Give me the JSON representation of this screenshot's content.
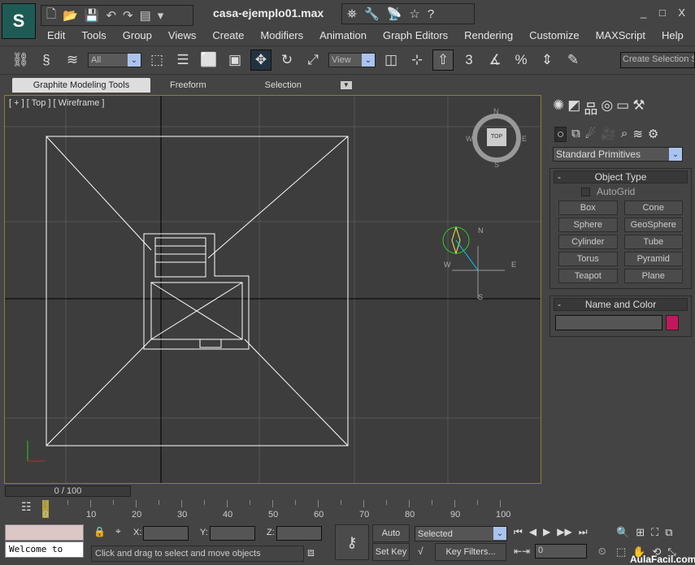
{
  "app": {
    "title": "casa-ejemplo01.max",
    "logo": "3ds-max-logo",
    "window_controls": "_ □ X"
  },
  "menu": [
    "Edit",
    "Tools",
    "Group",
    "Views",
    "Create",
    "Modifiers",
    "Animation",
    "Graph Editors",
    "Rendering",
    "Customize",
    "MAXScript",
    "Help"
  ],
  "toolbar": {
    "selection_filter": "All",
    "ref_coord": "View",
    "named_selection_placeholder": "Create Selection S",
    "snaps": [
      "3",
      "%"
    ]
  },
  "ribbon": {
    "tabs": [
      "Graphite Modeling Tools",
      "Freeform",
      "Selection"
    ]
  },
  "viewport": {
    "label": "[ + ] [ Top ] [ Wireframe ]",
    "viewcube": {
      "face": "TOP",
      "n": "N",
      "s": "S",
      "e": "E",
      "w": "W"
    },
    "compass": {
      "n": "N",
      "s": "S",
      "e": "E",
      "w": "W"
    }
  },
  "command_panel": {
    "dropdown": "Standard Primitives",
    "object_type": {
      "title": "Object Type",
      "autogrid": "AutoGrid",
      "autogrid_checked": false,
      "buttons": [
        "Box",
        "Cone",
        "Sphere",
        "GeoSphere",
        "Cylinder",
        "Tube",
        "Torus",
        "Pyramid",
        "Teapot",
        "Plane"
      ]
    },
    "name_color": {
      "title": "Name and Color",
      "name_value": "",
      "color": "#c2185b"
    }
  },
  "timeline": {
    "slider": "0 / 100",
    "current_frame": 0,
    "ticks": [
      "0",
      "10",
      "20",
      "30",
      "40",
      "50",
      "60",
      "70",
      "80",
      "90",
      "100"
    ]
  },
  "status": {
    "listener": "Welcome to",
    "prompt": "Click and drag to select and move objects",
    "x_label": "X:",
    "y_label": "Y:",
    "z_label": "Z:",
    "x": "",
    "y": "",
    "z": "",
    "auto_key": "Auto Key",
    "set_key": "Set Key",
    "key_mode": "Selected",
    "key_filters": "Key Filters...",
    "frame": "0",
    "watermark": "AulaFacil.com"
  }
}
